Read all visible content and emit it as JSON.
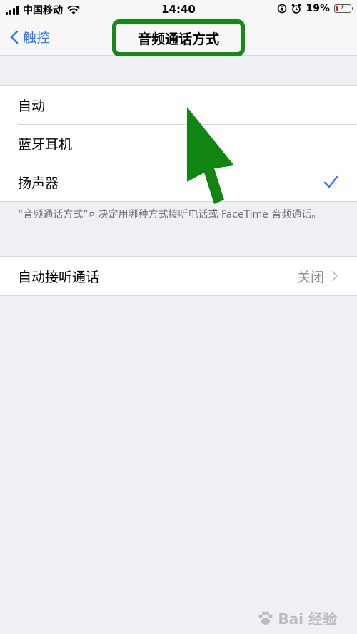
{
  "status_bar": {
    "carrier": "中国移动",
    "time": "14:40",
    "battery_percent": "19%"
  },
  "nav": {
    "back_label": "触控",
    "title": "音频通话方式"
  },
  "options": [
    {
      "label": "自动",
      "selected": false
    },
    {
      "label": "蓝牙耳机",
      "selected": false
    },
    {
      "label": "扬声器",
      "selected": true
    }
  ],
  "footnote": "“音频通话方式”可决定用哪种方式接听电话或 FaceTime 音频通话。",
  "auto_answer": {
    "label": "自动接听通话",
    "value": "关闭"
  },
  "watermark": {
    "text": "Bai 经验"
  },
  "colors": {
    "accent": "#3478f6",
    "highlight_frame": "#148a14",
    "background": "#efeff4"
  }
}
